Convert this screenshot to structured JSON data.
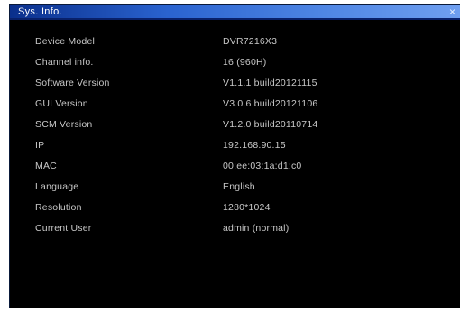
{
  "window": {
    "title": "Sys. Info.",
    "close_glyph": "×"
  },
  "icons": {
    "close": "close-icon"
  },
  "colors": {
    "titlebar_start": "#0a2f8c",
    "titlebar_end": "#6f9ff0",
    "background": "#000000",
    "text": "#c8c8c8"
  },
  "info": {
    "rows": [
      {
        "label": "Device Model",
        "value": "DVR7216X3"
      },
      {
        "label": "Channel info.",
        "value": "16 (960H)"
      },
      {
        "label": "Software Version",
        "value": "V1.1.1 build20121115"
      },
      {
        "label": "GUI Version",
        "value": "V3.0.6 build20121106"
      },
      {
        "label": "SCM Version",
        "value": "V1.2.0 build20110714"
      },
      {
        "label": "IP",
        "value": "192.168.90.15"
      },
      {
        "label": "MAC",
        "value": "00:ee:03:1a:d1:c0"
      },
      {
        "label": "Language",
        "value": "English"
      },
      {
        "label": "Resolution",
        "value": "1280*1024"
      },
      {
        "label": "Current User",
        "value": "admin (normal)"
      }
    ]
  }
}
